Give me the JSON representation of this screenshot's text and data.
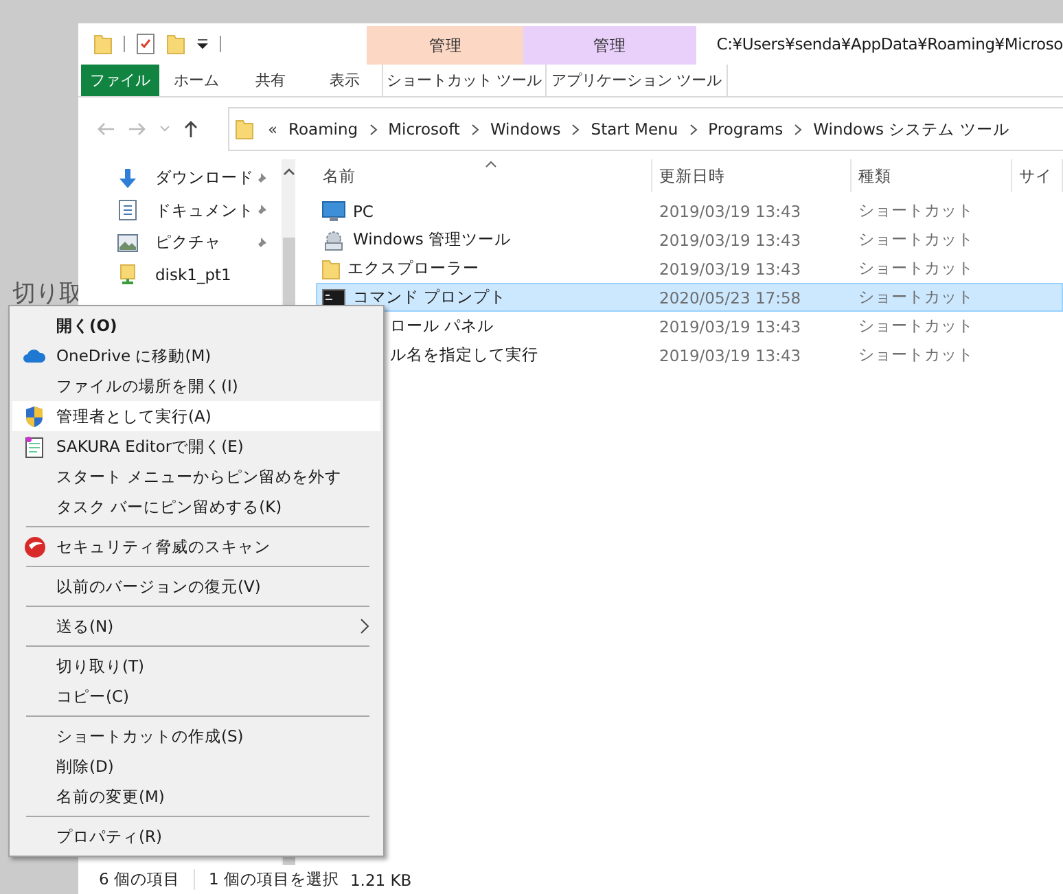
{
  "background_text": "切り取",
  "window": {
    "title": "C:¥Users¥senda¥AppData¥Roaming¥Microso"
  },
  "context_tabs": [
    {
      "group": "管理",
      "label": "ショートカット ツール",
      "color": "#fcd7c4"
    },
    {
      "group": "管理",
      "label": "アプリケーション ツール",
      "color": "#e8d0fa"
    }
  ],
  "ribbon_tabs": [
    {
      "label": "ファイル",
      "kind": "file"
    },
    {
      "label": "ホーム",
      "kind": "tab"
    },
    {
      "label": "共有",
      "kind": "tab"
    },
    {
      "label": "表示",
      "kind": "tab"
    }
  ],
  "breadcrumb": {
    "overflow": "«",
    "parts": [
      "Roaming",
      "Microsoft",
      "Windows",
      "Start Menu",
      "Programs",
      "Windows システム ツール"
    ]
  },
  "nav_items": [
    {
      "label": "ダウンロード",
      "kind": "download",
      "pinned": true
    },
    {
      "label": "ドキュメント",
      "kind": "document",
      "pinned": true
    },
    {
      "label": "ピクチャ",
      "kind": "picture",
      "pinned": true
    },
    {
      "label": "disk1_pt1",
      "kind": "drive",
      "pinned": false
    }
  ],
  "columns": [
    "名前",
    "更新日時",
    "種類",
    "サイ"
  ],
  "rows": [
    {
      "name": "PC",
      "modified": "2019/03/19 13:43",
      "type": "ショートカット",
      "kind": "pc",
      "selected": false
    },
    {
      "name": "Windows 管理ツール",
      "modified": "2019/03/19 13:43",
      "type": "ショートカット",
      "kind": "tools",
      "selected": false
    },
    {
      "name": "エクスプローラー",
      "modified": "2019/03/19 13:43",
      "type": "ショートカット",
      "kind": "folder",
      "selected": false
    },
    {
      "name": "コマンド プロンプト",
      "modified": "2020/05/23 17:58",
      "type": "ショートカット",
      "kind": "console",
      "selected": true
    },
    {
      "name": "ロール パネル",
      "modified": "2019/03/19 13:43",
      "type": "ショートカット",
      "kind": "covered",
      "selected": false
    },
    {
      "name": "ル名を指定して実行",
      "modified": "2019/03/19 13:43",
      "type": "ショートカット",
      "kind": "covered",
      "selected": false
    }
  ],
  "status_bar": {
    "count": "6 個の項目",
    "selection": "1 個の項目を選択",
    "size": "1.21 KB"
  },
  "context_menu": {
    "items": [
      {
        "kind": "item",
        "label": "開く(O)",
        "bold": true,
        "selected": false
      },
      {
        "kind": "cloud",
        "label": "OneDrive に移動(M)",
        "bold": false,
        "selected": false
      },
      {
        "kind": "item",
        "label": "ファイルの場所を開く(I)",
        "bold": false,
        "selected": false
      },
      {
        "kind": "shield",
        "label": "管理者として実行(A)",
        "bold": false,
        "selected": true
      },
      {
        "kind": "notepad",
        "label": "SAKURA Editorで開く(E)",
        "bold": false,
        "selected": false
      },
      {
        "kind": "item",
        "label": "スタート メニューからピン留めを外す",
        "bold": false,
        "selected": false
      },
      {
        "kind": "item",
        "label": "タスク バーにピン留めする(K)",
        "bold": false,
        "selected": false
      },
      {
        "kind": "separator"
      },
      {
        "kind": "security",
        "label": "セキュリティ脅威のスキャン",
        "bold": false,
        "selected": false
      },
      {
        "kind": "separator"
      },
      {
        "kind": "item",
        "label": "以前のバージョンの復元(V)",
        "bold": false,
        "selected": false
      },
      {
        "kind": "separator"
      },
      {
        "kind": "submenu",
        "label": "送る(N)",
        "bold": false,
        "selected": false
      },
      {
        "kind": "separator"
      },
      {
        "kind": "item",
        "label": "切り取り(T)",
        "bold": false,
        "selected": false
      },
      {
        "kind": "item",
        "label": "コピー(C)",
        "bold": false,
        "selected": false
      },
      {
        "kind": "separator"
      },
      {
        "kind": "item",
        "label": "ショートカットの作成(S)",
        "bold": false,
        "selected": false
      },
      {
        "kind": "item",
        "label": "削除(D)",
        "bold": false,
        "selected": false
      },
      {
        "kind": "item",
        "label": "名前の変更(M)",
        "bold": false,
        "selected": false
      },
      {
        "kind": "separator"
      },
      {
        "kind": "item",
        "label": "プロパティ(R)",
        "bold": false,
        "selected": false
      }
    ]
  }
}
